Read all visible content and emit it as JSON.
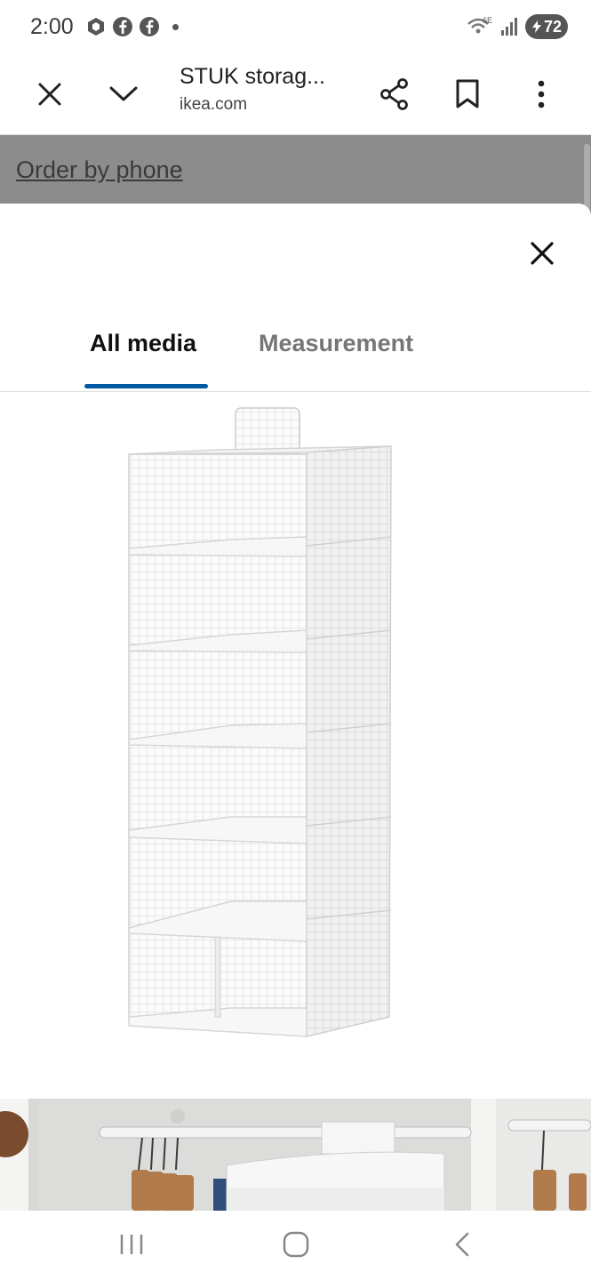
{
  "status_bar": {
    "time": "2:00",
    "network_label": "6E",
    "battery": "72",
    "icons": [
      "shield-app-icon",
      "facebook-icon",
      "facebook-icon",
      "notification-dot",
      "wifi-icon",
      "signal-icon",
      "battery-icon"
    ]
  },
  "browser": {
    "title": "STUK storag...",
    "url": "ikea.com",
    "icons": [
      "close-icon",
      "chevron-down-icon",
      "share-icon",
      "bookmark-icon",
      "more-vert-icon"
    ]
  },
  "page": {
    "order_link": "Order by phone"
  },
  "modal": {
    "close_icon": "close-icon",
    "tabs": [
      {
        "label": "All media",
        "active": true
      },
      {
        "label": "Measurement",
        "active": false
      }
    ],
    "accent_color": "#0058a3"
  },
  "nav_bar": {
    "icons": [
      "recent-apps-icon",
      "home-icon",
      "back-icon"
    ]
  }
}
